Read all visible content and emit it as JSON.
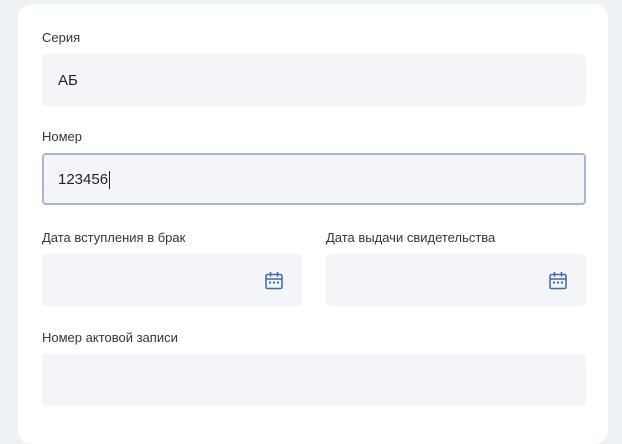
{
  "form": {
    "series": {
      "label": "Серия",
      "value": "АБ"
    },
    "number": {
      "label": "Номер",
      "value": "123456"
    },
    "marriage_date": {
      "label": "Дата вступления в брак",
      "value": "",
      "icon": "calendar-icon"
    },
    "issue_date": {
      "label": "Дата выдачи свидетельства",
      "value": "",
      "icon": "calendar-icon"
    },
    "record_number": {
      "label": "Номер актовой записи",
      "value": ""
    }
  },
  "colors": {
    "input_bg": "#f3f5f9",
    "focus_border": "#a6b7d3",
    "icon": "#3a6ab0"
  }
}
